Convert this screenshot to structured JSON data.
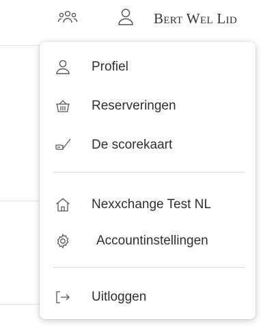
{
  "header": {
    "user_name": "Bert Wel Lid",
    "icons": [
      "group-icon",
      "user-icon"
    ]
  },
  "menu": {
    "items": [
      {
        "label": "Profiel",
        "icon": "user-icon"
      },
      {
        "label": "Reserveringen",
        "icon": "basket-icon"
      },
      {
        "label": "De scorekaart",
        "icon": "golf-club-icon"
      },
      {
        "label": "Nexxchange Test NL",
        "icon": "home-icon"
      },
      {
        "label": "Accountinstellingen",
        "icon": "gear-icon"
      },
      {
        "label": "Uitloggen",
        "icon": "logout-icon"
      }
    ]
  },
  "colors": {
    "icon_stroke": "#555555",
    "text": "#2e2e2e",
    "divider": "#d8d8d8"
  }
}
